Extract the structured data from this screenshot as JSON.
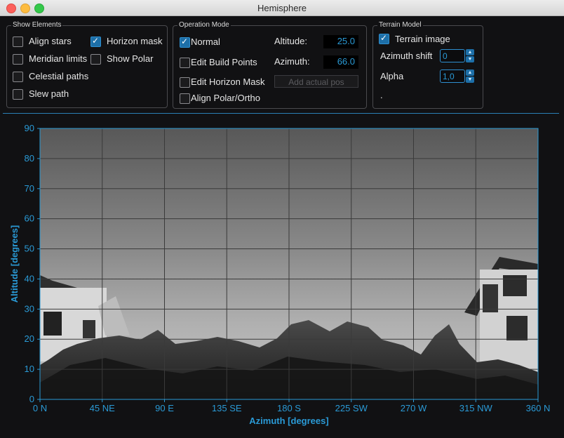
{
  "window": {
    "title": "Hemisphere"
  },
  "show_elements": {
    "legend": "Show Elements",
    "align_stars": {
      "label": "Align stars",
      "checked": false
    },
    "horizon_mask": {
      "label": "Horizon mask",
      "checked": true
    },
    "meridian_limits": {
      "label": "Meridian limits",
      "checked": false
    },
    "show_polar": {
      "label": "Show Polar",
      "checked": false
    },
    "celestial_paths": {
      "label": "Celestial paths",
      "checked": false
    },
    "slew_path": {
      "label": "Slew path",
      "checked": false
    }
  },
  "operation_mode": {
    "legend": "Operation Mode",
    "normal": {
      "label": "Normal",
      "checked": true
    },
    "edit_build_points": {
      "label": "Edit Build Points",
      "checked": false
    },
    "edit_horizon_mask": {
      "label": "Edit Horizon Mask",
      "checked": false
    },
    "align_polar": {
      "label": "Align Polar/Ortho",
      "checked": false
    },
    "altitude_label": "Altitude:",
    "altitude_value": "25.0",
    "azimuth_label": "Azimuth:",
    "azimuth_value": "66.0",
    "add_actual_pos": "Add actual pos"
  },
  "terrain_model": {
    "legend": "Terrain Model",
    "terrain_image": {
      "label": "Terrain image",
      "checked": true
    },
    "azimuth_shift_label": "Azimuth shift",
    "azimuth_shift_value": "0",
    "alpha_label": "Alpha",
    "alpha_value": "1,0",
    "dot": "."
  },
  "chart_data": {
    "type": "heatmap",
    "xlabel": "Azimuth [degrees]",
    "ylabel": "Altitude [degrees]",
    "xlim": [
      0,
      360
    ],
    "ylim": [
      0,
      90
    ],
    "x_ticks": [
      0,
      45,
      90,
      135,
      180,
      225,
      270,
      315,
      360
    ],
    "x_tick_labels": [
      "0 N",
      "45 NE",
      "90 E",
      "135 SE",
      "180 S",
      "225 SW",
      "270 W",
      "315 NW",
      "360 N"
    ],
    "y_ticks": [
      0,
      10,
      20,
      30,
      40,
      50,
      60,
      70,
      80,
      90
    ],
    "y_tick_labels": [
      "0",
      "10",
      "20",
      "30",
      "40",
      "50",
      "60",
      "70",
      "80",
      "90"
    ],
    "grid": true,
    "colors": {
      "axis": "#2a9ad6",
      "grid": "#3a3a3a"
    }
  }
}
